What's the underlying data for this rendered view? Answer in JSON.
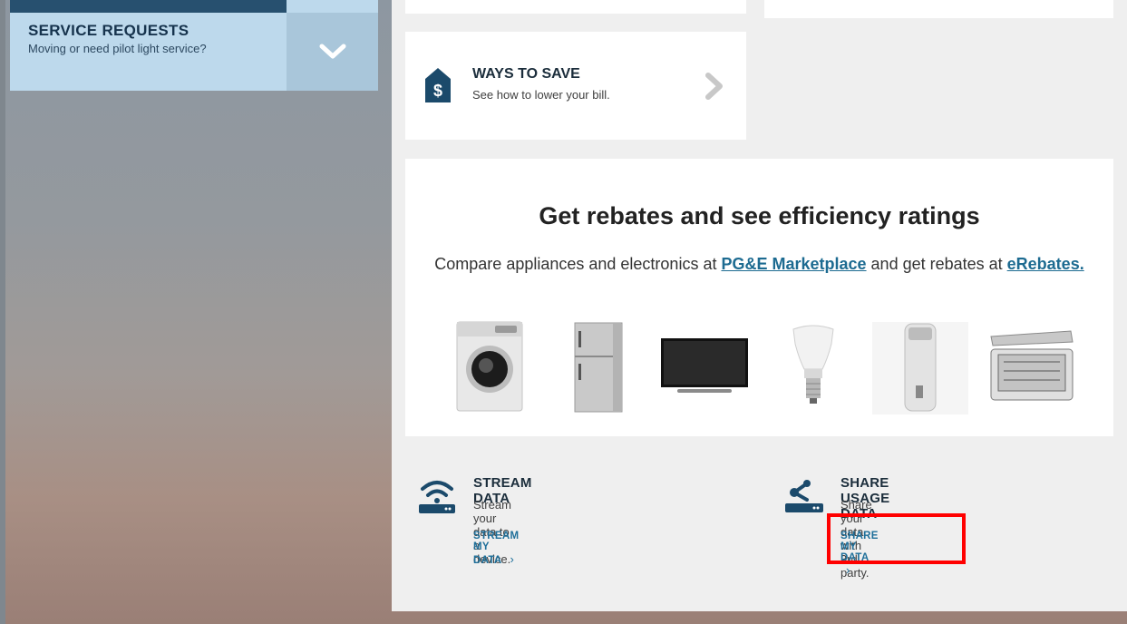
{
  "service_requests": {
    "title": "SERVICE REQUESTS",
    "subtitle": "Moving or need pilot light service?",
    "toggle_icon": "chevron-down-icon"
  },
  "ways_to_save": {
    "title": "WAYS TO SAVE",
    "subtitle": "See how to lower your bill.",
    "icon": "dollar-tag-icon",
    "arrow_icon": "chevron-right-icon"
  },
  "rebates": {
    "heading": "Get rebates and see efficiency ratings",
    "desc_prefix": "Compare appliances and electronics at ",
    "marketplace_link": "PG&E Marketplace",
    "desc_middle": " and get rebates at ",
    "erebates_link": "eRebates.",
    "appliances": [
      "washing-machine-image",
      "refrigerator-image",
      "television-image",
      "light-bulb-image",
      "water-heater-image",
      "freezer-image"
    ]
  },
  "stream_data": {
    "title": "STREAM DATA",
    "subtitle": "Stream your data to a device.",
    "link": "STREAM MY DATA",
    "link_arrow": "›",
    "icon": "wifi-router-icon"
  },
  "share_usage": {
    "title": "SHARE USAGE DATA",
    "subtitle": "Share your data with 3rd party.",
    "link": "SHARE MY DATA",
    "link_arrow": "›",
    "icon": "share-router-icon"
  },
  "colors": {
    "accent_dark": "#1b4a6b",
    "link": "#1e6f9a",
    "highlight": "#ff0000"
  }
}
